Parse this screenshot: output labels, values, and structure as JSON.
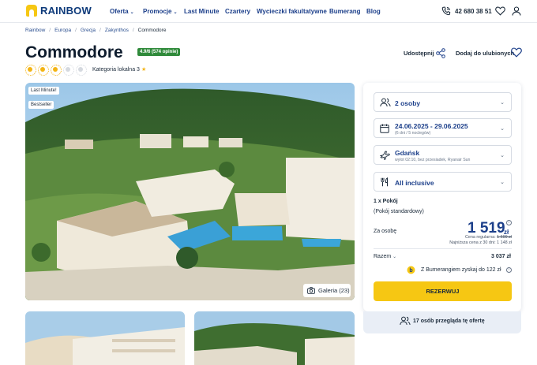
{
  "header": {
    "logo_text": "RAINBOW",
    "nav": [
      {
        "label": "Oferta",
        "dropdown": true
      },
      {
        "label": "Promocje",
        "dropdown": true
      },
      {
        "label": "Last Minute",
        "dropdown": false
      },
      {
        "label": "Czartery",
        "dropdown": false
      },
      {
        "label": "Wycieczki fakultatywne",
        "dropdown": false
      },
      {
        "label": "Bumerang",
        "dropdown": false
      },
      {
        "label": "Blog",
        "dropdown": false
      }
    ],
    "phone": "42 680 38 51",
    "icons": [
      "phone-icon",
      "heart-icon",
      "user-icon"
    ]
  },
  "breadcrumb": [
    "Rainbow",
    "Europa",
    "Grecja",
    "Zakynthos",
    "Commodore"
  ],
  "hotel": {
    "name": "Commodore",
    "rating_badge": "4.9/6 (574 opinie)",
    "suns_filled": 3,
    "suns_total": 5,
    "category": "Kategoria lokalna 3"
  },
  "actions": {
    "share": "Udostępnij",
    "favorite": "Dodaj do ulubionych"
  },
  "photo": {
    "tags": [
      "Last Minute!",
      "Bestseller"
    ],
    "gallery_label": "Galeria (23)"
  },
  "booking": {
    "guests": "2 osoby",
    "dates": "24.06.2025 - 29.06.2025",
    "dates_sub": "(6 dni / 5 noclegów)",
    "departure": "Gdańsk",
    "departure_sub": "wylot 02:10, bez przesiadek, Ryanair Sun",
    "board": "All inclusive",
    "room_count": "1 x Pokój",
    "room_type": "(Pokój standardowy)",
    "per_person_label": "Za osobę",
    "price": "1 519",
    "currency": "zł",
    "regular_price_label": "Cena regularna:",
    "regular_price": "1 699 zł",
    "lowest_30_days": "Najniższa cena z 30 dni: 1 148 zł",
    "total_label": "Razem",
    "total": "3 037 zł",
    "bumerang": "Z Bumerangiem zyskaj do 122 zł",
    "reserve": "REZERWUJ",
    "watchers": "17 osób przegląda tę ofertę"
  },
  "colors": {
    "brand_blue": "#1c3f8a",
    "brand_yellow": "#f6c713",
    "rating_green": "#2f8a3a"
  }
}
